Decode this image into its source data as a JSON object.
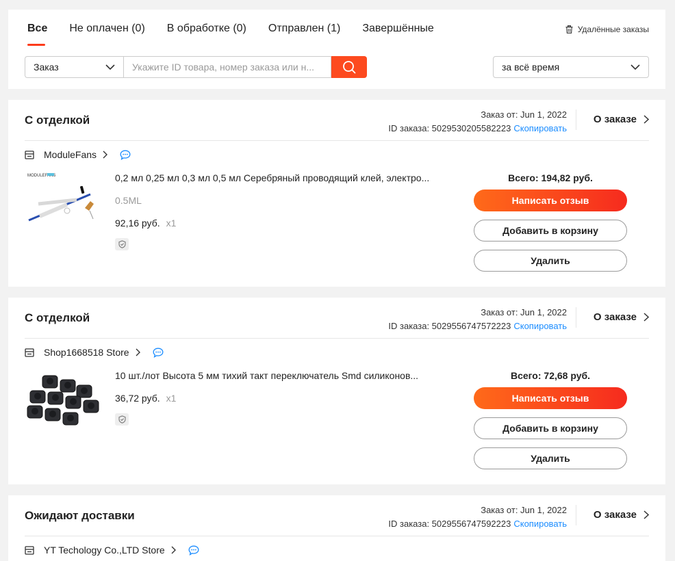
{
  "tabs": [
    {
      "label": "Все",
      "active": true
    },
    {
      "label": "Не оплачен (0)",
      "active": false
    },
    {
      "label": "В обработке (0)",
      "active": false
    },
    {
      "label": "Отправлен (1)",
      "active": false
    },
    {
      "label": "Завершённые",
      "active": false
    }
  ],
  "deleted_orders_label": "Удалённые заказы",
  "search": {
    "type_value": "Заказ",
    "placeholder": "Укажите ID товара, номер заказа или н...",
    "period_value": "за всё время"
  },
  "colors": {
    "accent": "#fd4a1f",
    "link": "#1a8cff",
    "background": "#f2f2f2"
  },
  "orders": [
    {
      "status": "С отделкой",
      "date_label": "Заказ от: Jun 1, 2022",
      "id_label": "ID заказа: 5029530205582223",
      "copy_label": "Скопировать",
      "about_label": "О заказе",
      "store_name": "ModuleFans",
      "product_title": "0,2 мл 0,25 мл 0,3 мл 0,5 мл Серебряный проводящий клей, электро...",
      "variant": "0.5ML",
      "price": "92,16 руб.",
      "qty": "x1",
      "total": "Всего: 194,82 руб.",
      "btn_review": "Написать отзыв",
      "btn_cart": "Добавить в корзину",
      "btn_delete": "Удалить"
    },
    {
      "status": "С отделкой",
      "date_label": "Заказ от: Jun 1, 2022",
      "id_label": "ID заказа: 5029556747572223",
      "copy_label": "Скопировать",
      "about_label": "О заказе",
      "store_name": "Shop1668518 Store",
      "product_title": "10 шт./лот Высота 5 мм тихий такт переключатель Smd силиконов...",
      "variant": "",
      "price": "36,72 руб.",
      "qty": "x1",
      "total": "Всего: 72,68 руб.",
      "btn_review": "Написать отзыв",
      "btn_cart": "Добавить в корзину",
      "btn_delete": "Удалить"
    },
    {
      "status": "Ожидают доставки",
      "date_label": "Заказ от: Jun 1, 2022",
      "id_label": "ID заказа: 5029556747592223",
      "copy_label": "Скопировать",
      "about_label": "О заказе",
      "store_name": "YT Techology Co.,LTD Store"
    }
  ],
  "product_image_logo_text": "MODULEFANS"
}
